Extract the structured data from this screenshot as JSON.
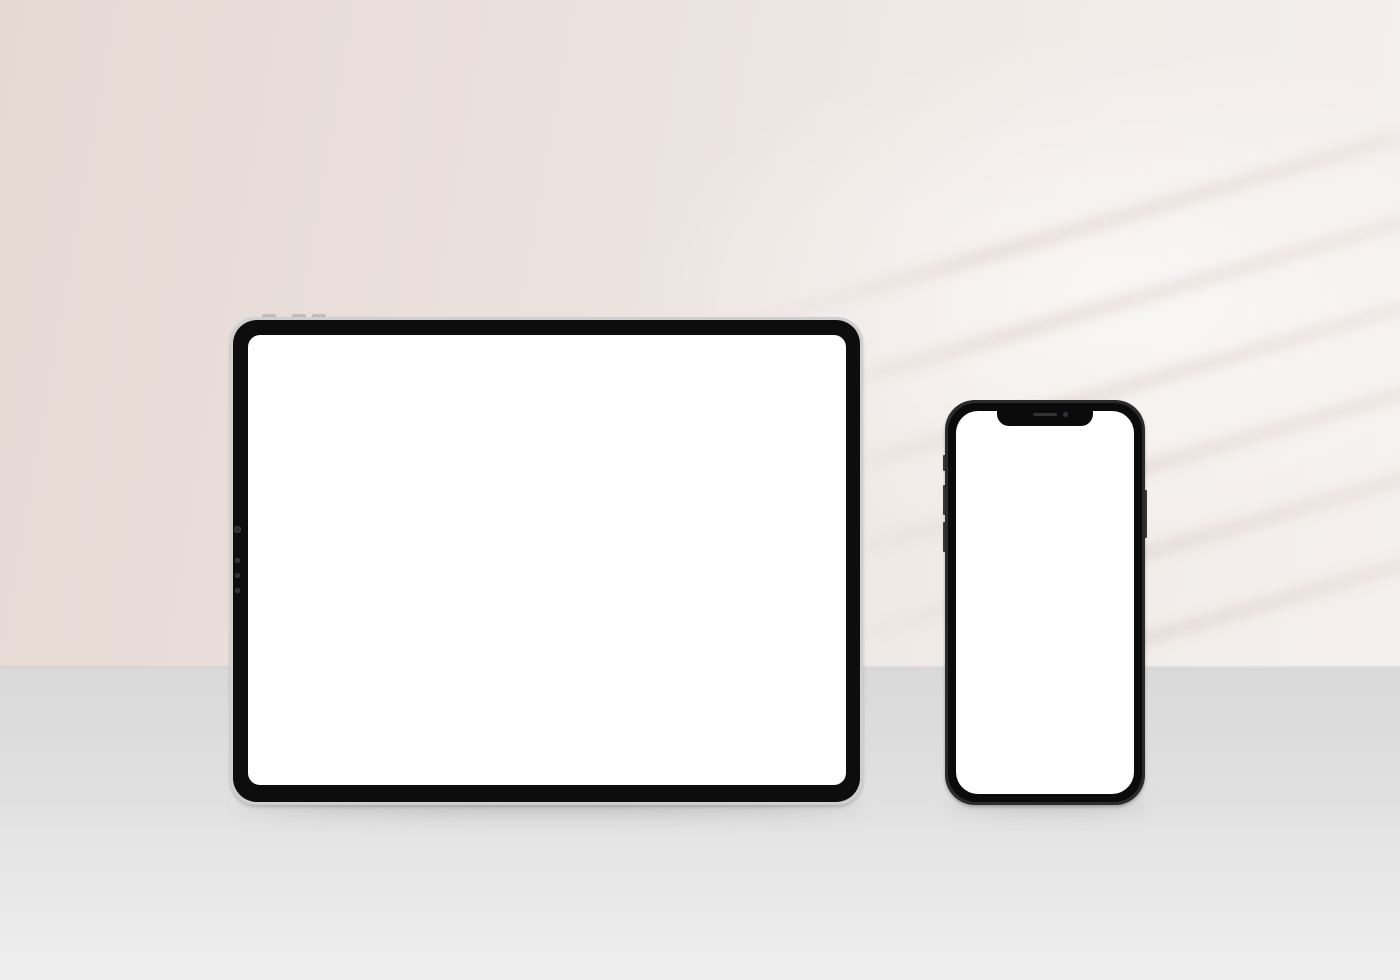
{
  "scene": {
    "description_label": "",
    "colors": {
      "wall": "#eae0dc",
      "floor": "#e0e0e0",
      "device_bezel": "#0d0d0d",
      "screen": "#ffffff"
    },
    "devices": [
      {
        "kind": "tablet",
        "screen_state": "blank"
      },
      {
        "kind": "phone",
        "screen_state": "blank"
      }
    ]
  }
}
